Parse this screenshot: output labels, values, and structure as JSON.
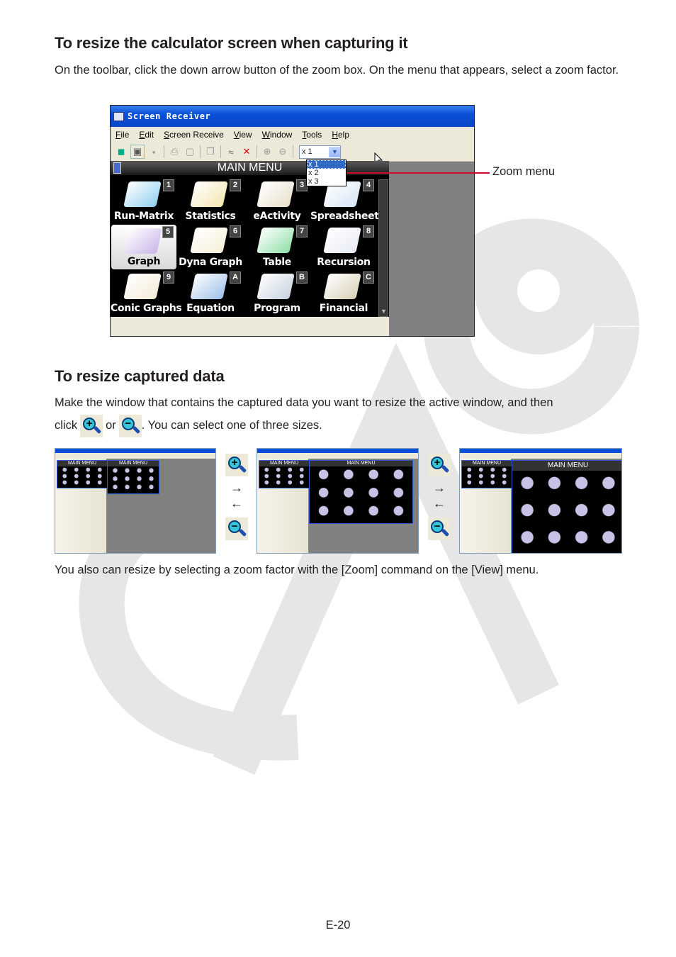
{
  "section1": {
    "heading": "To resize the calculator screen when capturing it",
    "body": "On the toolbar, click the down arrow button of the zoom box. On the menu that appears, select a zoom factor."
  },
  "window": {
    "title": "Screen Receiver",
    "menu": [
      {
        "label": "File",
        "underline": "F",
        "rest": "ile"
      },
      {
        "label": "Edit",
        "underline": "E",
        "rest": "dit"
      },
      {
        "label": "Screen Receive",
        "underline": "S",
        "rest": "creen Receive"
      },
      {
        "label": "View",
        "underline": "V",
        "rest": "iew"
      },
      {
        "label": "Window",
        "underline": "W",
        "rest": "indow"
      },
      {
        "label": "Tools",
        "underline": "T",
        "rest": "ools"
      },
      {
        "label": "Help",
        "underline": "H",
        "rest": "elp"
      }
    ],
    "toolbar_icons": [
      "capture-icon",
      "new-icon",
      "save-icon",
      "print-icon",
      "print-preview-icon",
      "copy-icon",
      "link-icon",
      "unlink-icon",
      "zoom-in-icon",
      "zoom-out-icon"
    ],
    "zoom_box": {
      "value": "x 1",
      "options": [
        "x 1",
        "x 2",
        "x 3"
      ],
      "selected": "x 1"
    },
    "calculator": {
      "title": "MAIN MENU",
      "items": [
        {
          "num": "1",
          "label": "Run-Matrix",
          "color": "#8fd0f0"
        },
        {
          "num": "2",
          "label": "Statistics",
          "color": "#f3e6b0"
        },
        {
          "num": "3",
          "label": "eActivity",
          "color": "#e8e0cc"
        },
        {
          "num": "4",
          "label": "Spreadsheet",
          "color": "#d8e6f5"
        },
        {
          "num": "5",
          "label": "Graph",
          "color": "#c9b5e8",
          "selected": true
        },
        {
          "num": "6",
          "label": "Dyna Graph",
          "color": "#f5f0d8"
        },
        {
          "num": "7",
          "label": "Table",
          "color": "#8fe0a8"
        },
        {
          "num": "8",
          "label": "Recursion",
          "color": "#e8ecf5"
        },
        {
          "num": "9",
          "label": "Conic Graphs",
          "color": "#f5ecd8"
        },
        {
          "num": "A",
          "label": "Equation",
          "color": "#9fc0e8"
        },
        {
          "num": "B",
          "label": "Program",
          "color": "#c8d2e0"
        },
        {
          "num": "C",
          "label": "Financial",
          "color": "#d8d0b8"
        }
      ]
    }
  },
  "callout": {
    "label": "Zoom menu",
    "color": "#c8102e"
  },
  "section2": {
    "heading": "To resize captured data",
    "body_line1": "Make the window that contains the captured data you want to resize the active window, and then",
    "body_click": "click",
    "body_or": "or",
    "body_rest": ". You can select one of three sizes.",
    "zoom_in_icon": "zoom-in-icon",
    "zoom_out_icon": "zoom-out-icon",
    "thumbnails": [
      {
        "zoom": "x 1",
        "title": "MAIN MENU"
      },
      {
        "zoom": "x 2",
        "title": "MAIN MENU"
      },
      {
        "zoom": "x 3",
        "title": "MAIN MENU"
      }
    ],
    "arrow_right": "→",
    "arrow_left": "←",
    "footnote": "You also can resize by selecting a zoom factor with the [Zoom] command on the [View] menu."
  },
  "watermark": "CASIO",
  "page_number": "E-20"
}
